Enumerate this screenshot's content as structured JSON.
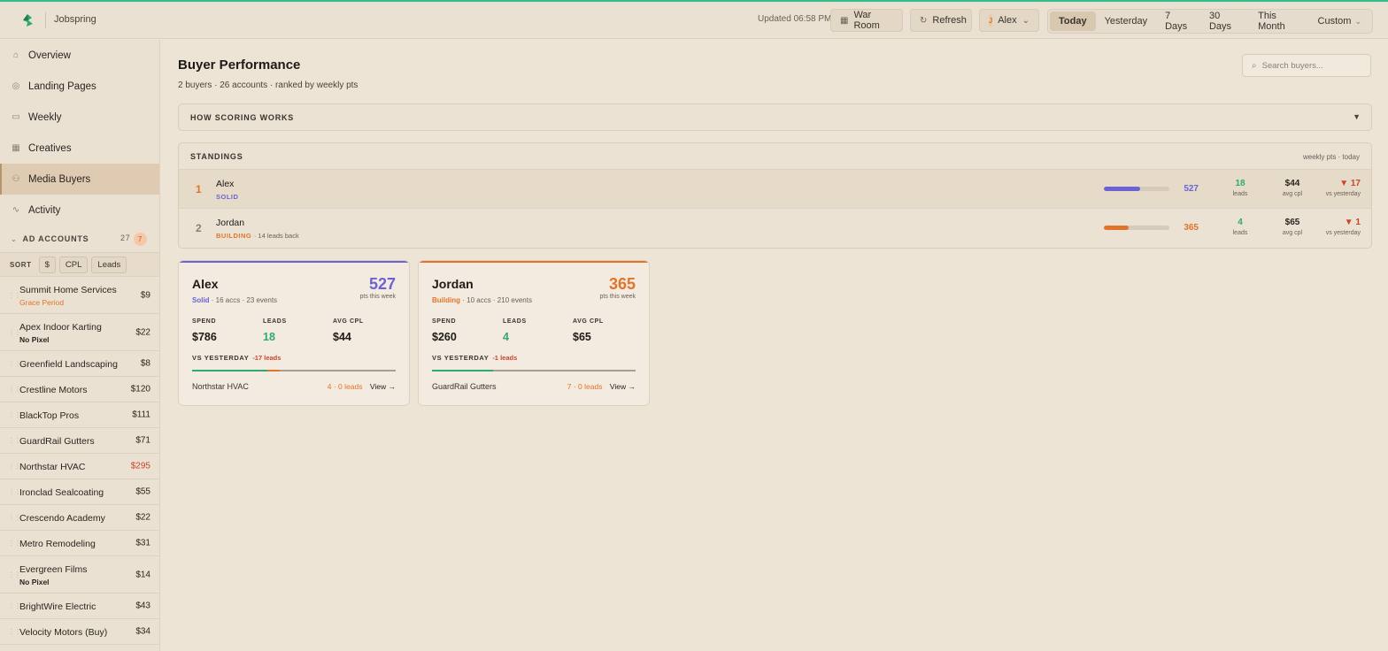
{
  "app": {
    "brand": "Jobspring",
    "updated": "Updated 06:58 PM"
  },
  "header": {
    "war_room": "War Room",
    "refresh": "Refresh",
    "user_initial": "J",
    "user_name": "Alex",
    "ranges": [
      "Today",
      "Yesterday",
      "7 Days",
      "30 Days",
      "This Month",
      "Custom"
    ],
    "active_range": "Today"
  },
  "sidebar": {
    "nav": [
      {
        "label": "Overview",
        "icon": "home-icon"
      },
      {
        "label": "Landing Pages",
        "icon": "globe-icon"
      },
      {
        "label": "Weekly",
        "icon": "calendar-icon"
      },
      {
        "label": "Creatives",
        "icon": "grid-icon"
      },
      {
        "label": "Media Buyers",
        "icon": "users-icon",
        "active": true
      },
      {
        "label": "Activity",
        "icon": "activity-icon"
      }
    ],
    "accounts_title": "AD ACCOUNTS",
    "accounts_count": "27",
    "accounts_badge": "7",
    "sort_label": "SORT",
    "sort_buttons": [
      "$",
      "CPL",
      "Leads"
    ],
    "accounts": [
      {
        "name": "Summit Home Services",
        "sub": "Grace Period",
        "sub_style": "orange",
        "value": "$9"
      },
      {
        "name": "Apex Indoor Karting",
        "sub": "No Pixel",
        "sub_style": "dark",
        "value": "$22"
      },
      {
        "name": "Greenfield Landscaping",
        "value": "$8"
      },
      {
        "name": "Crestline Motors",
        "value": "$120"
      },
      {
        "name": "BlackTop Pros",
        "value": "$111"
      },
      {
        "name": "GuardRail Gutters",
        "value": "$71"
      },
      {
        "name": "Northstar HVAC",
        "value": "$295",
        "value_style": "red"
      },
      {
        "name": "Ironclad Sealcoating",
        "value": "$55"
      },
      {
        "name": "Crescendo Academy",
        "value": "$22"
      },
      {
        "name": "Metro Remodeling",
        "value": "$31"
      },
      {
        "name": "Evergreen Films",
        "sub": "No Pixel",
        "sub_style": "dark",
        "value": "$14"
      },
      {
        "name": "BrightWire Electric",
        "value": "$43"
      },
      {
        "name": "Velocity Motors (Buy)",
        "value": "$34"
      }
    ]
  },
  "main": {
    "title": "Buyer Performance",
    "subtitle": "2 buyers · 26 accounts · ranked by weekly pts",
    "search_placeholder": "Search buyers...",
    "how_scoring": "HOW SCORING WORKS",
    "standings_title": "STANDINGS",
    "standings_meta": "weekly pts · today",
    "standings": [
      {
        "rank": "1",
        "name": "Alex",
        "tier": "SOLID",
        "back": "",
        "progress": 0.55,
        "pts": "527",
        "leads": "18",
        "leads_label": "leads",
        "cpl": "$44",
        "cpl_label": "avg cpl",
        "vs": "▼ 17",
        "vs_label": "vs yesterday",
        "color": "#6b63d4",
        "rank_color": "#e0742a",
        "leads_color": "#2fa96e"
      },
      {
        "rank": "2",
        "name": "Jordan",
        "tier": "BUILDING",
        "back": "· 14 leads back",
        "progress": 0.38,
        "pts": "365",
        "leads": "4",
        "leads_label": "leads",
        "cpl": "$65",
        "cpl_label": "avg cpl",
        "vs": "▼ 1",
        "vs_label": "vs yesterday",
        "color": "#e0742a",
        "rank_color": "#8a7f74",
        "leads_color": "#2fa96e"
      }
    ],
    "cards": [
      {
        "name": "Alex",
        "tier": "Solid",
        "meta": "· 16 accs · 23 events",
        "pts": "527",
        "pts_label": "pts this week",
        "spend_label": "SPEND",
        "spend": "$786",
        "leads_label": "LEADS",
        "leads": "18",
        "cpl_label": "AVG CPL",
        "cpl": "$44",
        "vs_label": "VS YESTERDAY",
        "vs_delta": "-17 leads",
        "green_frac": 0.37,
        "red_frac": 0.06,
        "top_account": "Northstar HVAC",
        "top_leads": "4 · 0 leads",
        "view": "View →",
        "color": "#6b63d4"
      },
      {
        "name": "Jordan",
        "tier": "Building",
        "meta": "· 10 accs · 210 events",
        "pts": "365",
        "pts_label": "pts this week",
        "spend_label": "SPEND",
        "spend": "$260",
        "leads_label": "LEADS",
        "leads": "4",
        "cpl_label": "AVG CPL",
        "cpl": "$65",
        "vs_label": "VS YESTERDAY",
        "vs_delta": "-1 leads",
        "green_frac": 0.3,
        "red_frac": 0.0,
        "top_account": "GuardRail Gutters",
        "top_leads": "7 · 0 leads",
        "view": "View →",
        "color": "#e0742a"
      }
    ]
  },
  "colors": {
    "accent_green": "#2fbf8c",
    "solid": "#6b63d4",
    "building": "#e0742a",
    "down": "#c9452c"
  }
}
